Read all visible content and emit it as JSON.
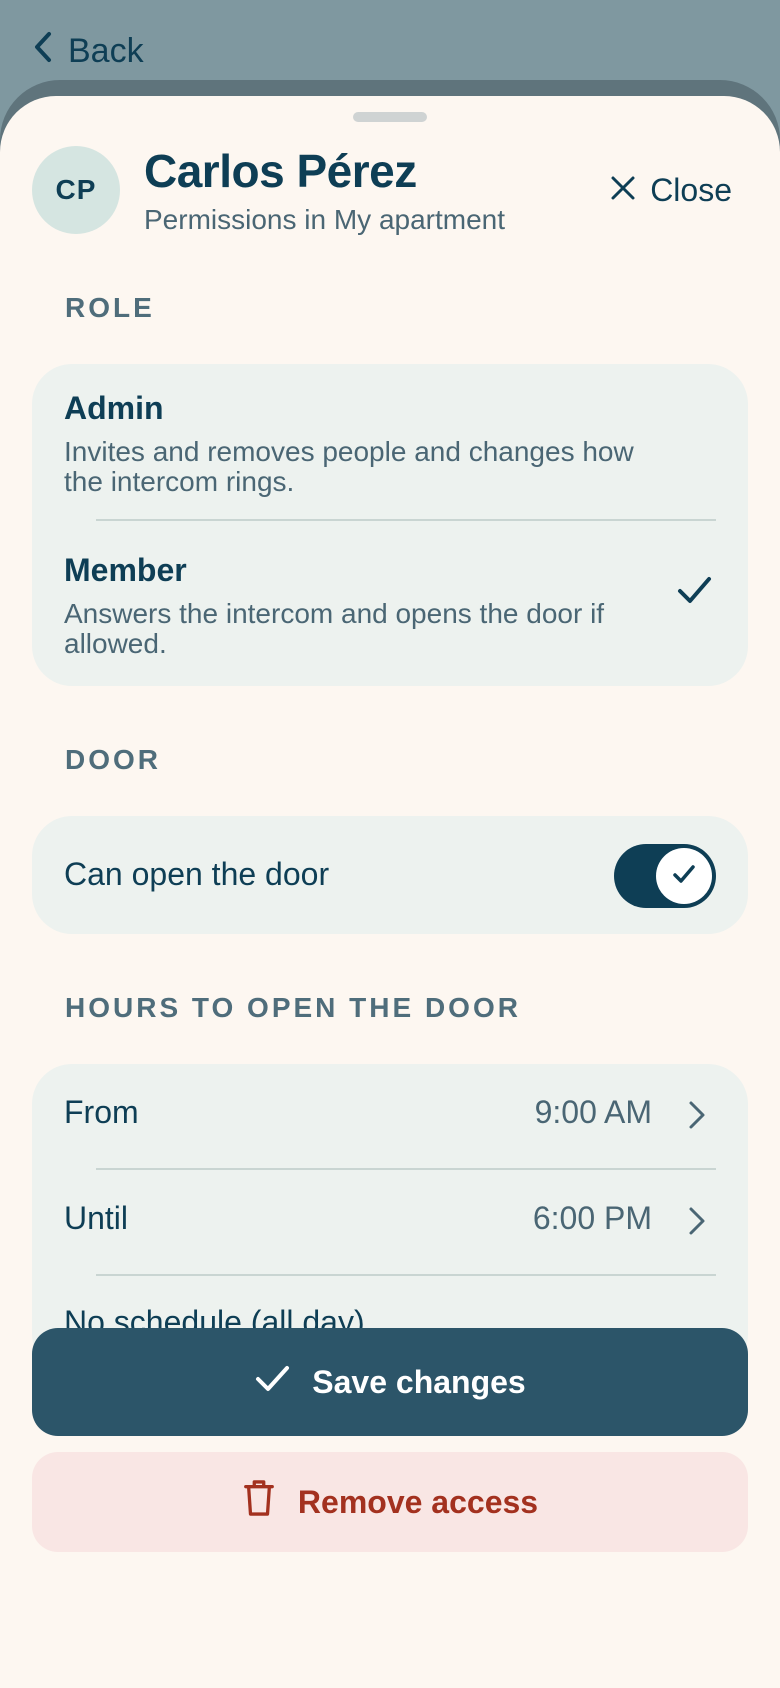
{
  "nav": {
    "back_label": "Back"
  },
  "header": {
    "avatar_initials": "CP",
    "name": "Carlos Pérez",
    "subtitle": "Permissions in My apartment",
    "close_label": "Close"
  },
  "role": {
    "section_label": "ROLE",
    "options": [
      {
        "title": "Admin",
        "description": "Invites and removes people and changes how the intercom rings.",
        "selected": false
      },
      {
        "title": "Member",
        "description": "Answers the intercom and opens the door if allowed.",
        "selected": true
      }
    ]
  },
  "door": {
    "section_label": "DOOR",
    "can_open_label": "Can open the door",
    "can_open_enabled": true
  },
  "hours": {
    "section_label": "HOURS TO OPEN THE DOOR",
    "from_label": "From",
    "from_value": "9:00 AM",
    "until_label": "Until",
    "until_value": "6:00 PM",
    "no_schedule_label": "No schedule (all day)"
  },
  "actions": {
    "save_label": "Save changes",
    "remove_label": "Remove access"
  },
  "colors": {
    "primary": "#0e3e55",
    "save_button": "#2c5569",
    "danger": "#a3311f",
    "danger_bg": "#f9e6e4",
    "sheet_bg": "#fdf7f1",
    "card_bg": "#edf2ef"
  },
  "icons": {
    "back": "chevron-left-icon",
    "close": "close-icon",
    "selected": "checkmark-icon",
    "toggle": "checkmark-icon",
    "row_nav": "chevron-right-icon",
    "save": "checkmark-icon",
    "remove": "trash-icon"
  }
}
